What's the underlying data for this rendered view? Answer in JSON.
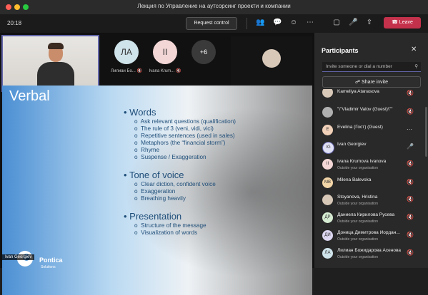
{
  "window": {
    "title": "Лекция по Управление на аутсорсинг проекти и компании"
  },
  "toolbar": {
    "time": "20:18",
    "request_control": "Request control",
    "leave": "Leave"
  },
  "tiles": [
    {
      "initials": "ЛА",
      "name": "Лилиан Бо...",
      "color": "#cfe3ea"
    },
    {
      "initials": "II",
      "name": "Ivana Krum...",
      "color": "#f3d6d6"
    },
    {
      "initials": "+6",
      "name": "",
      "color": "#3a3a3a"
    }
  ],
  "slide": {
    "title": "Verbal",
    "sections": [
      {
        "heading": "Words",
        "bullets": [
          "Ask relevant questions (qualification)",
          "The rule of 3 (veni, vidi, vici)",
          "Repetitive sentences (used in sales)",
          "Metaphors (the “financial storm”)",
          "Rhyme",
          "Suspense / Exaggeration"
        ]
      },
      {
        "heading": "Tone of voice",
        "bullets": [
          "Clear diction, confident voice",
          "Exaggeration",
          "Breathing heavily"
        ]
      },
      {
        "heading": "Presentation",
        "bullets": [
          "Structure of the message",
          "Visualization of words"
        ]
      }
    ],
    "logo_name": "Pontica",
    "logo_sub": "Solutions",
    "speaker_label": "Ivan Georgiev"
  },
  "panel": {
    "title": "Participants",
    "search_placeholder": "Invite someone or dial a number",
    "share_invite": "Share invite",
    "participants": [
      {
        "initials": "",
        "name": "Kameliya Atanasova",
        "sub": "",
        "color": "#d8c8b8"
      },
      {
        "initials": "",
        "name": "\"\\\"Vladimir Valov (Guest)\\\"\"",
        "sub": "",
        "color": "#b0b0b0"
      },
      {
        "initials": "E",
        "name": "Evelina (Гост) (Guest)",
        "sub": "",
        "color": "#f0d0b8"
      },
      {
        "initials": "IG",
        "name": "Ivan Georgiev",
        "sub": "",
        "color": "#e0e0f5"
      },
      {
        "initials": "II",
        "name": "Ivana Krumova Ivanova",
        "sub": "Outside your organisation",
        "color": "#f3d6d6"
      },
      {
        "initials": "MB",
        "name": "Milena Balevska",
        "sub": "",
        "color": "#f3d6a8"
      },
      {
        "initials": "",
        "name": "Stoyanova, Hristina",
        "sub": "Outside your organisation",
        "color": "#d8c8b8"
      },
      {
        "initials": "ДР",
        "name": "Даниела Кирилова Русева",
        "sub": "Outside your organisation",
        "color": "#d6ecd2"
      },
      {
        "initials": "ДИ",
        "name": "Доница Димитрова Йордан...",
        "sub": "Outside your organisation",
        "color": "#dcd6f0"
      },
      {
        "initials": "ЛА",
        "name": "Лилиан Божидарова Асенова",
        "sub": "Outside your organisation",
        "color": "#cfe3ea"
      }
    ]
  }
}
